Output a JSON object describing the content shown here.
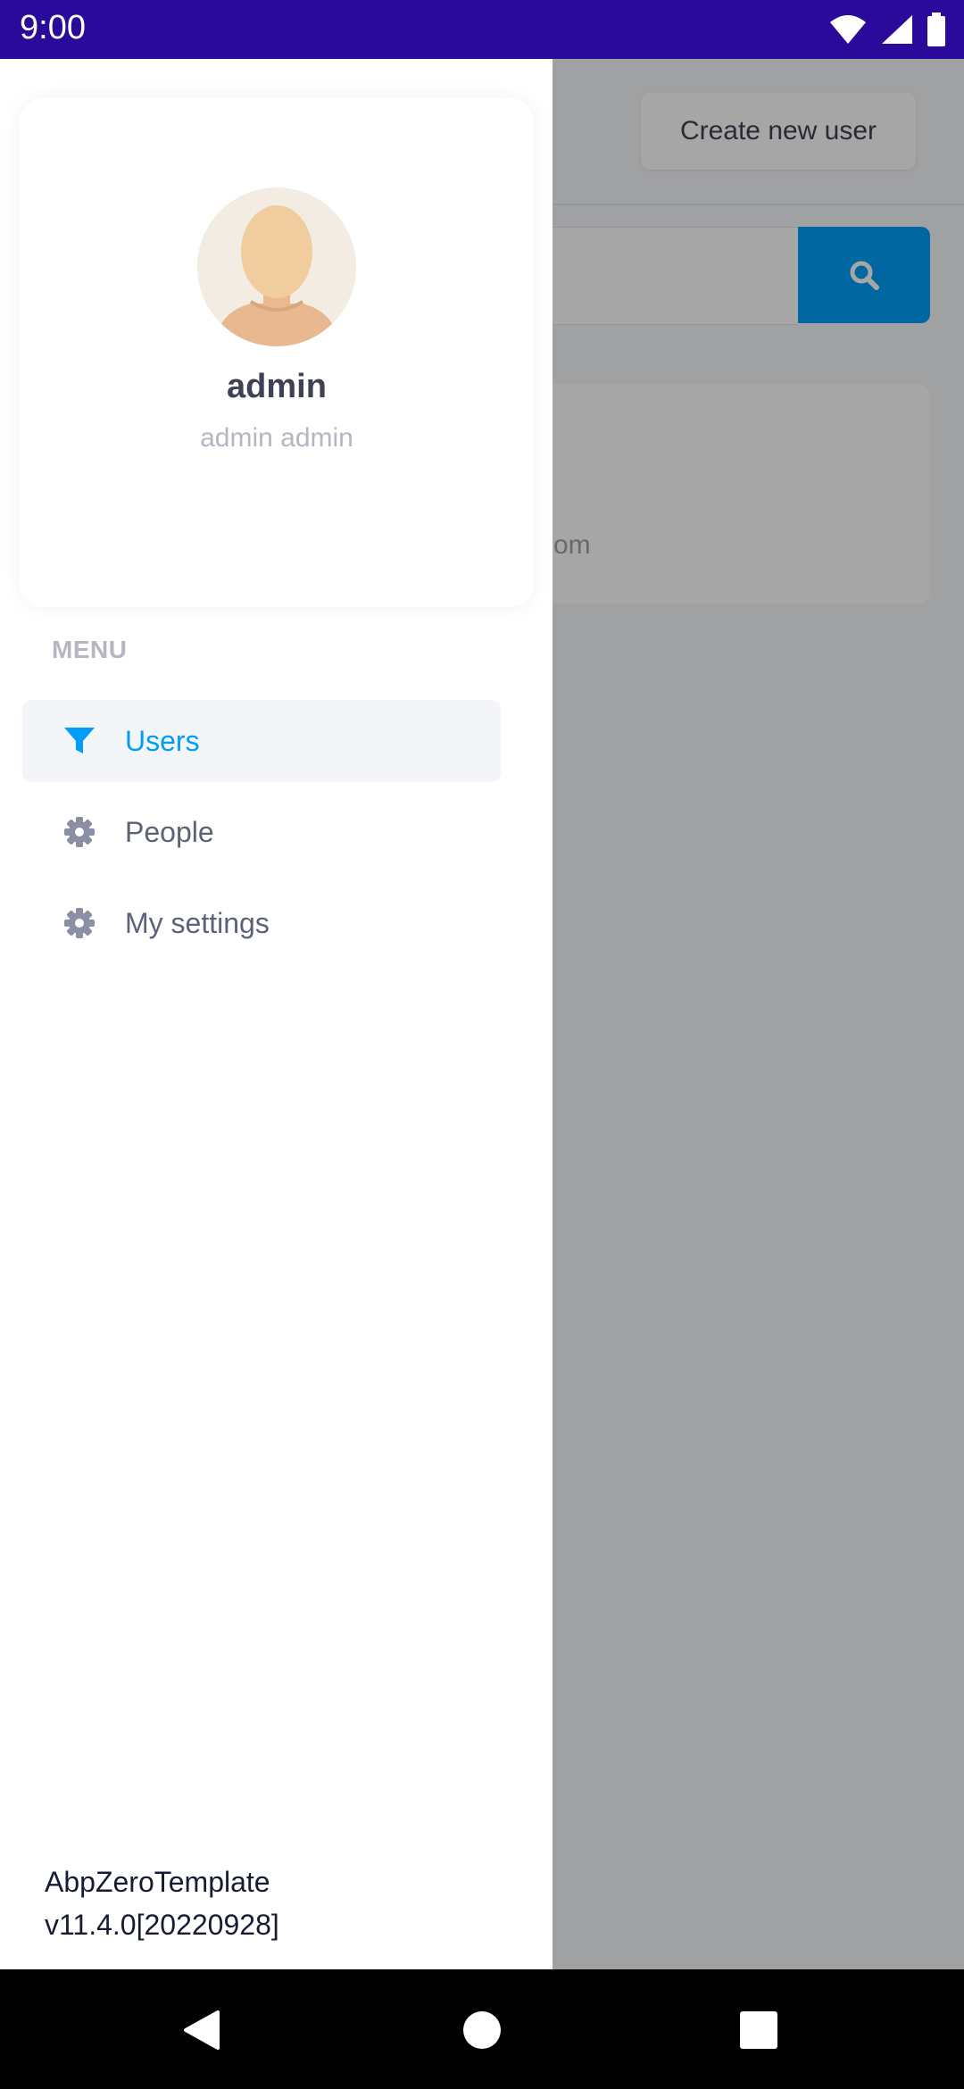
{
  "status_bar": {
    "time": "9:00"
  },
  "background": {
    "create_button_label": "Create new user",
    "card_email_fragment": "om"
  },
  "drawer": {
    "profile": {
      "username": "admin",
      "full_name": "admin admin"
    },
    "menu_header": "MENU",
    "items": [
      {
        "label": "Users",
        "icon": "filter-icon",
        "active": true
      },
      {
        "label": "People",
        "icon": "gear-icon",
        "active": false
      },
      {
        "label": "My settings",
        "icon": "gear-icon",
        "active": false
      }
    ],
    "footer": {
      "app_name": "AbpZeroTemplate",
      "version": "v11.4.0[20220928]"
    }
  },
  "colors": {
    "status_bar": "#2a0a9b",
    "accent": "#009ef7",
    "active_item_bg": "#f3f5f9"
  }
}
